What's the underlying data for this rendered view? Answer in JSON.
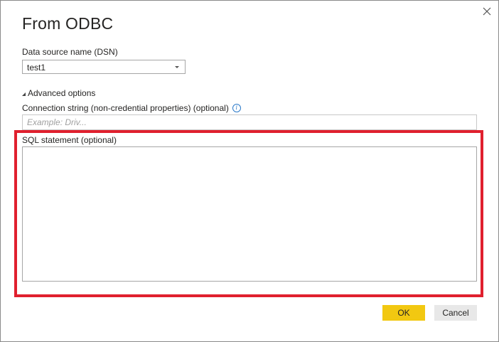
{
  "dialog": {
    "title": "From ODBC",
    "close_icon": "close-icon"
  },
  "dsn": {
    "label": "Data source name (DSN)",
    "selected": "test1"
  },
  "advanced": {
    "label": "Advanced options",
    "expanded": true
  },
  "connection_string": {
    "label": "Connection string (non-credential properties) (optional)",
    "info_icon": "info-icon",
    "value": "",
    "placeholder": "Example: Driv..."
  },
  "sql": {
    "label": "SQL statement (optional)",
    "value": "",
    "highlight_color": "#e0202e"
  },
  "buttons": {
    "ok_label": "OK",
    "cancel_label": "Cancel",
    "ok_color": "#f2c811"
  }
}
